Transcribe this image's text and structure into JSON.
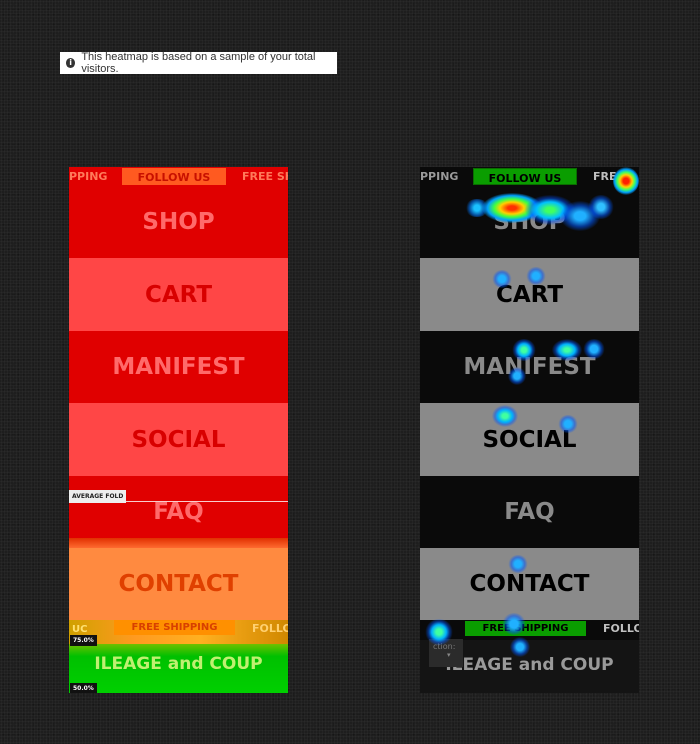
{
  "notice": {
    "icon": "info-icon",
    "text": "This heatmap is based on a sample of your total visitors."
  },
  "left_panel": {
    "topbar": {
      "item_left": "PPING",
      "follow": "FOLLOW US",
      "item_right": "FREE SH"
    },
    "bands": [
      "SHOP",
      "CART",
      "MANIFEST",
      "SOCIAL",
      "FAQ",
      "CONTACT"
    ],
    "fold_label": "AVERAGE FOLD",
    "bottom_bar": {
      "left": "UC",
      "shipping": "FREE SHIPPING",
      "right": "FOLLO"
    },
    "mileage": "ILEAGE and COUP",
    "pct_75": "75.0%",
    "pct_50": "50.0%"
  },
  "right_panel": {
    "topbar": {
      "item_left": "PPING",
      "follow": "FOLLOW US",
      "item_right": "FRE"
    },
    "bands": [
      "SHOP",
      "CART",
      "MANIFEST",
      "SOCIAL",
      "FAQ",
      "CONTACT"
    ],
    "bottom_bar": {
      "shipping": "FREE SHIPPING",
      "right": "FOLLO"
    },
    "dropdown": "ction:",
    "mileage": "ILEAGE and COUP"
  },
  "colors": {
    "heat_red": "#e00000",
    "heat_light_red": "#ff4040",
    "heat_orange": "#ff8040",
    "heat_green": "#00c000",
    "accent_green": "#0a9d00"
  }
}
